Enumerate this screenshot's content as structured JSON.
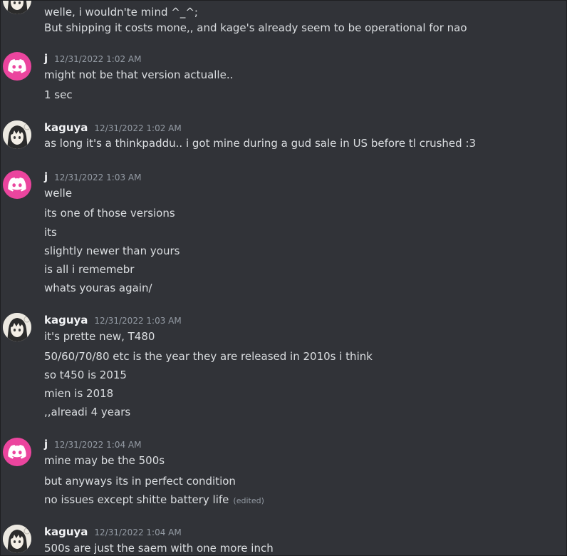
{
  "messages": [
    {
      "lines": [
        "welle, i wouldn'te mind ^_^;",
        "But shipping it costs mone,, and kage's already seem to be operational for nao"
      ]
    },
    {
      "username": "j",
      "avatar_icon": "discord-logo-icon",
      "timestamp": "12/31/2022 1:02 AM",
      "lines": [
        "might not be that version actualle..",
        "1 sec"
      ]
    },
    {
      "username": "kaguya",
      "avatar_icon": "anime-girl-avatar",
      "timestamp": "12/31/2022 1:02 AM",
      "lines": [
        "as long it's a thinkpaddu.. i got mine during a gud sale in US before tl crushed :3"
      ]
    },
    {
      "username": "j",
      "avatar_icon": "discord-logo-icon",
      "timestamp": "12/31/2022 1:03 AM",
      "lines": [
        "welle",
        "its one of those versions",
        "its",
        "slightly newer than yours",
        "is all i rememebr",
        "whats youras again/"
      ]
    },
    {
      "username": "kaguya",
      "avatar_icon": "anime-girl-avatar",
      "timestamp": "12/31/2022 1:03 AM",
      "lines": [
        "it's prette new, T480",
        "50/60/70/80 etc is the year they are released in 2010s i think",
        "so t450 is 2015",
        "mien is 2018",
        ",,alreadi 4 years"
      ]
    },
    {
      "username": "j",
      "avatar_icon": "discord-logo-icon",
      "timestamp": "12/31/2022 1:04 AM",
      "lines": [
        "mine may be the 500s",
        "but anyways its in perfect condition",
        "no issues except shitte battery life"
      ],
      "edited_label": "(edited)"
    },
    {
      "username": "kaguya",
      "avatar_icon": "anime-girl-avatar",
      "timestamp": "12/31/2022 1:04 AM",
      "lines": [
        "500s are just the saem with one more inch"
      ]
    }
  ],
  "colors": {
    "background": "#313338",
    "discord_pink": "#eb459e",
    "text": "#dbdee1",
    "username": "#f2f3f5",
    "timestamp": "#949ba4"
  }
}
